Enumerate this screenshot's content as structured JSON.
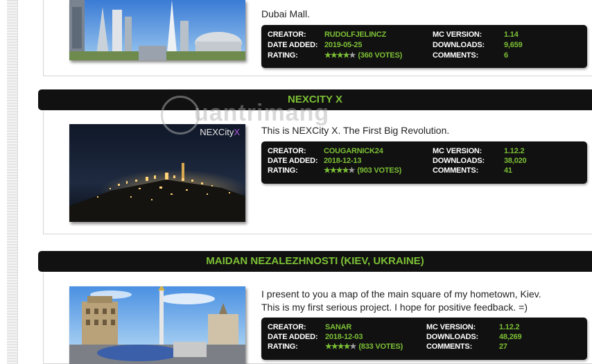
{
  "entries": [
    {
      "title": "",
      "description_lines": [
        "Dubai Mall."
      ],
      "creator_label": "CREATOR:",
      "creator": "RUDOLFJELINCZ",
      "date_label": "DATE ADDED:",
      "date": "2019-05-25",
      "rating_label": "RATING:",
      "stars": "★★★★",
      "half_star": "★",
      "votes": "(360 VOTES)",
      "mc_label": "MC VERSION:",
      "mc_version": "1.14",
      "downloads_label": "DOWNLOADS:",
      "downloads": "9,659",
      "comments_label": "COMMENTS:",
      "comments": "6"
    },
    {
      "title": "NEXCITY X",
      "thumb_logo": "NEXCity",
      "thumb_logo_x": "X",
      "description_lines": [
        "This is NEXCity X. The First Big Revolution."
      ],
      "creator_label": "CREATOR:",
      "creator": "COUGARNICK24",
      "date_label": "DATE ADDED:",
      "date": "2018-12-13",
      "rating_label": "RATING:",
      "stars": "★★★★",
      "half_star": "★",
      "votes": "(903 VOTES)",
      "mc_label": "MC VERSION:",
      "mc_version": "1.12.2",
      "downloads_label": "DOWNLOADS:",
      "downloads": "38,020",
      "comments_label": "COMMENTS:",
      "comments": "41"
    },
    {
      "title": "MAIDAN NEZALEZHNOSTI (KIEV, UKRAINE)",
      "description_lines": [
        "I present to you a map of the main square of my hometown, Kiev.",
        "This is my first serious project. I hope for positive feedback. =)"
      ],
      "creator_label": "CREATOR:",
      "creator": "SANAR",
      "date_label": "DATE ADDED:",
      "date": "2018-12-03",
      "rating_label": "RATING:",
      "stars": "★★★★",
      "half_star": "★",
      "votes": "(833 VOTES)",
      "mc_label": "MC VERSION:",
      "mc_version": "1.12.2",
      "downloads_label": "DOWNLOADS:",
      "downloads": "48,269",
      "comments_label": "COMMENTS:",
      "comments": "27"
    }
  ],
  "watermark": "uantrimang",
  "colors": {
    "accent": "#7cc035",
    "panel": "#111111",
    "text": "#222222"
  }
}
